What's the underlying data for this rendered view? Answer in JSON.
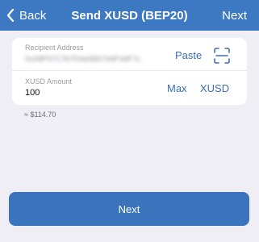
{
  "header": {
    "back_label": "Back",
    "title": "Send XUSD (BEP20)",
    "next_label": "Next",
    "back_icon": "chevron-left-icon"
  },
  "recipient": {
    "label": "Recipient Address",
    "value": "0xA8F57C7b7D4e98A7b9F4dF7c",
    "paste_label": "Paste",
    "scan_icon": "qr-scan-icon"
  },
  "amount": {
    "label": "XUSD Amount",
    "value": "100",
    "max_label": "Max",
    "unit_label": "XUSD"
  },
  "fiat_estimate": "≈ $114.70",
  "footer": {
    "next_label": "Next"
  },
  "colors": {
    "header_bg": "#3d79c3",
    "accent": "#3a6fb5",
    "button_bg": "#3b74bd",
    "page_bg": "#efeef4"
  }
}
